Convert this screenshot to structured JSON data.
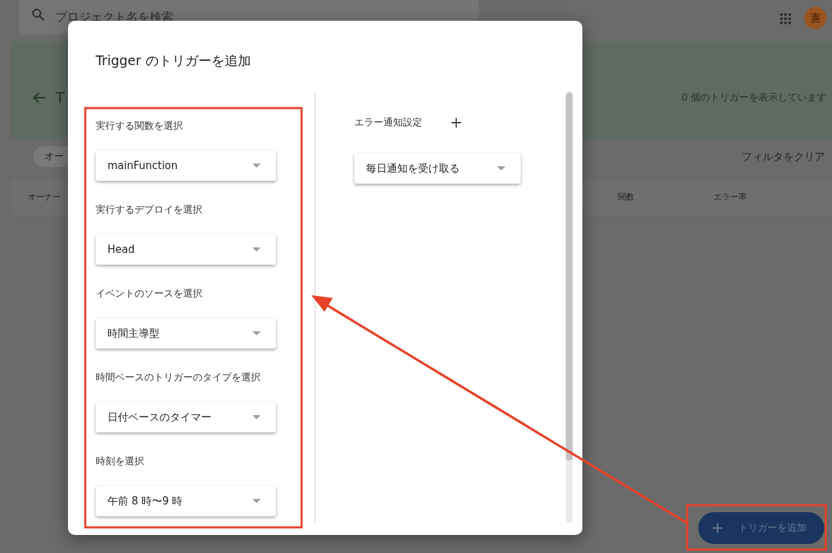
{
  "search": {
    "placeholder": "プロジェクト名を検索"
  },
  "account": {
    "avatar": "憲"
  },
  "header": {
    "title": "T",
    "summary": "0 個のトリガーを表示しています"
  },
  "filters": {
    "chip": "オー",
    "clear": "フィルタをクリア"
  },
  "table": {
    "columns": [
      "オーナー",
      "関数",
      "エラー率"
    ]
  },
  "dialog": {
    "title": "Trigger のトリガーを追加",
    "fields": [
      {
        "label": "実行する関数を選択",
        "value": "mainFunction"
      },
      {
        "label": "実行するデプロイを選択",
        "value": "Head"
      },
      {
        "label": "イベントのソースを選択",
        "value": "時間主導型"
      },
      {
        "label": "時間ベースのトリガーのタイプを選択",
        "value": "日付ベースのタイマー"
      },
      {
        "label": "時刻を選択",
        "value": "午前 8 時〜9 時"
      }
    ],
    "notification": {
      "label": "エラー通知設定",
      "value": "毎日通知を受け取る"
    }
  },
  "fab": {
    "label": "トリガーを追加"
  }
}
